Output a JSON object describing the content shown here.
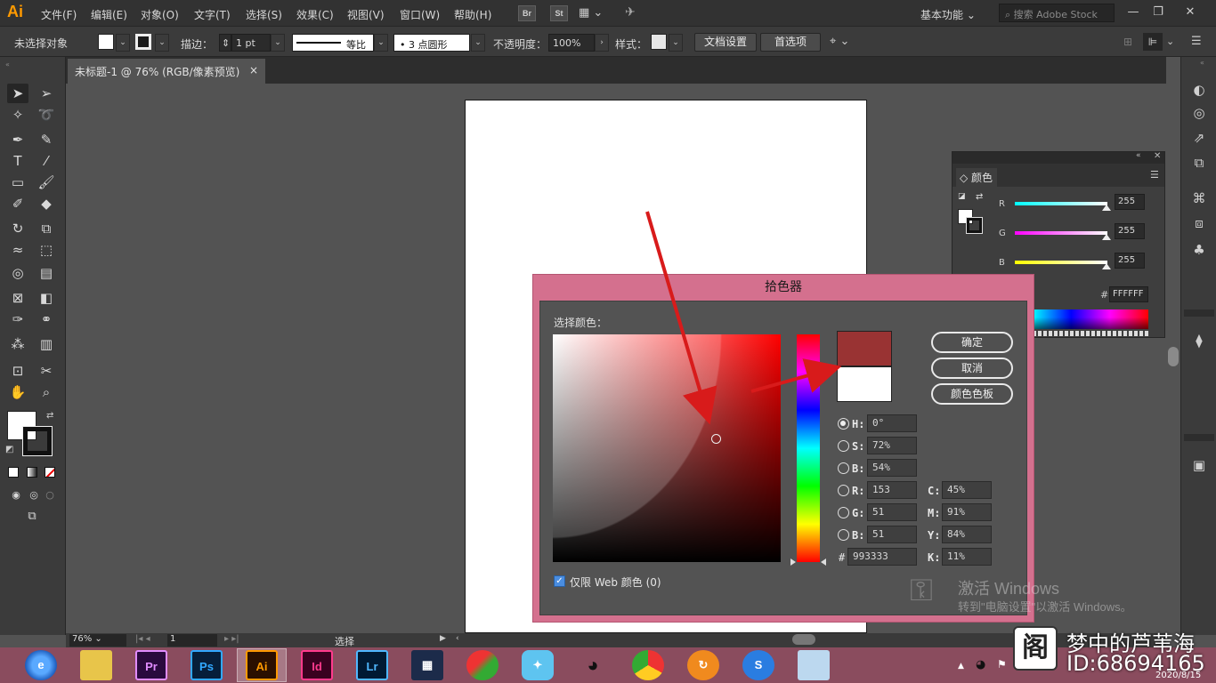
{
  "app": {
    "logo": "Ai",
    "colors": {
      "accent": "#ff9a00",
      "picker_frame": "#d4708e",
      "current_color": "#993333"
    }
  },
  "menu": {
    "items": [
      "文件(F)",
      "编辑(E)",
      "对象(O)",
      "文字(T)",
      "选择(S)",
      "效果(C)",
      "视图(V)",
      "窗口(W)",
      "帮助(H)"
    ],
    "bridge": "Br",
    "stock": "St",
    "workspace": "基本功能",
    "search_placeholder": "搜索 Adobe Stock"
  },
  "control": {
    "no_selection": "未选择对象",
    "stroke_label": "描边：",
    "stroke_value": "1 pt",
    "stroke_profile": "等比",
    "brush": "3 点圆形",
    "opacity_label": "不透明度：",
    "opacity_value": "100%",
    "style_label": "样式：",
    "doc_setup": "文档设置",
    "preferences": "首选项"
  },
  "document_tab": {
    "title": "未标题-1 @ 76% (RGB/像素预览)",
    "close": "×"
  },
  "color_panel": {
    "title": "颜色",
    "channels": [
      {
        "label": "R",
        "value": "255"
      },
      {
        "label": "G",
        "value": "255"
      },
      {
        "label": "B",
        "value": "255"
      }
    ],
    "hex": "FFFFFF"
  },
  "picker": {
    "title": "拾色器",
    "select_label": "选择颜色：",
    "ok": "确定",
    "cancel": "取消",
    "swatches": "颜色色板",
    "fields": {
      "h_label": "H:",
      "h": "0°",
      "s_label": "S:",
      "s": "72%",
      "b_label": "B:",
      "b": "54%",
      "r_label": "R:",
      "r": "153",
      "g_label": "G:",
      "g": "51",
      "bl_label": "B:",
      "bl": "51",
      "c_label": "C:",
      "c": "45%",
      "m_label": "M:",
      "m": "91%",
      "y_label": "Y:",
      "y": "84%",
      "k_label": "K:",
      "k": "11%",
      "hex_label": "#",
      "hex": "993333"
    },
    "web_only": "仅限 Web 颜色 (0)"
  },
  "status": {
    "zoom": "76%",
    "page": "1",
    "tool": "选择"
  },
  "watermark": {
    "line1": "激活 Windows",
    "line2": "转到\"电脑设置\"以激活 Windows。"
  },
  "taskbar": {
    "apps": [
      {
        "icon": "browser-icon",
        "label": "e"
      },
      {
        "icon": "folder-icon",
        "label": ""
      },
      {
        "icon": "premiere-icon",
        "label": "Pr"
      },
      {
        "icon": "photoshop-icon",
        "label": "Ps"
      },
      {
        "icon": "illustrator-icon",
        "label": "Ai"
      },
      {
        "icon": "indesign-icon",
        "label": "Id"
      },
      {
        "icon": "lightroom-icon",
        "label": "Lr"
      },
      {
        "icon": "video-icon",
        "label": ""
      },
      {
        "icon": "app-icon",
        "label": ""
      },
      {
        "icon": "bird-icon",
        "label": ""
      },
      {
        "icon": "qq-icon",
        "label": ""
      },
      {
        "icon": "chrome-icon",
        "label": ""
      },
      {
        "icon": "orange-icon",
        "label": ""
      },
      {
        "icon": "sogou-icon",
        "label": "S"
      },
      {
        "icon": "notes-icon",
        "label": ""
      }
    ],
    "clock_date": "2020/8/15",
    "brand_overlay": "梦中的芦苇海",
    "brand_id": "ID:68694165"
  }
}
